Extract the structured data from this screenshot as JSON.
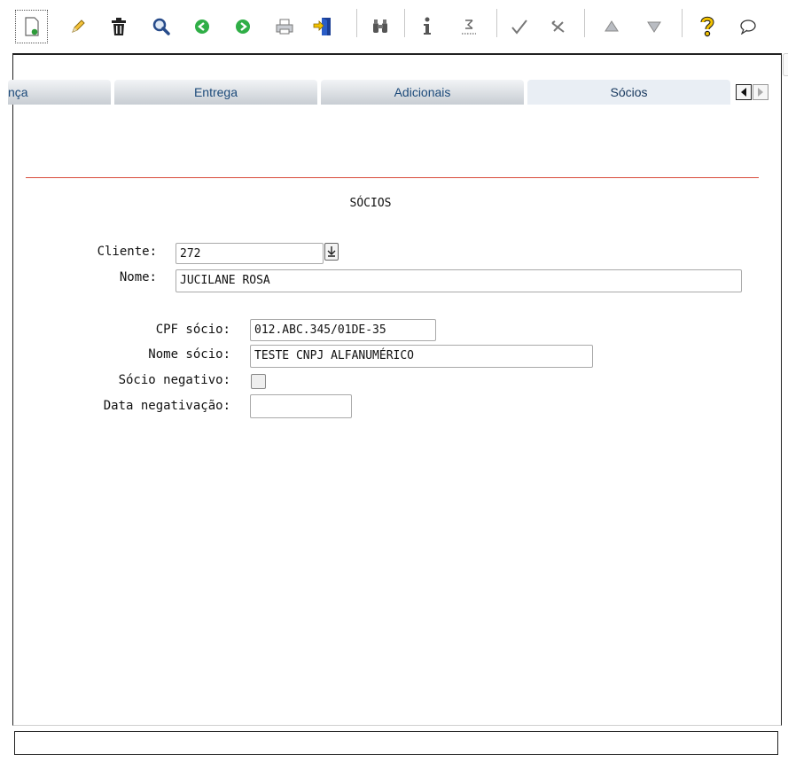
{
  "toolbar": {
    "icons": [
      "new-record-icon",
      "edit-icon",
      "delete-icon",
      "search-icon",
      "previous-icon",
      "next-icon",
      "print-icon",
      "exit-icon",
      "binoculars-icon",
      "info-icon",
      "sum-icon",
      "confirm-icon",
      "cancel-icon",
      "up-icon",
      "down-icon",
      "help-icon",
      "comment-icon"
    ]
  },
  "tabs": [
    {
      "label": "nça"
    },
    {
      "label": "Entrega"
    },
    {
      "label": "Adicionais"
    },
    {
      "label": "Sócios"
    }
  ],
  "form": {
    "section_title": "SÓCIOS",
    "cliente_label": "Cliente:",
    "cliente_value": "272",
    "nome_label": "Nome:",
    "nome_value": "JUCILANE ROSA",
    "cpf_label": "CPF sócio:",
    "cpf_value": "012.ABC.345/01DE-35",
    "nome_socio_label": "Nome sócio:",
    "nome_socio_value": "TESTE CNPJ ALFANUMÉRICO",
    "socio_negativo_label": "Sócio negativo:",
    "socio_negativo_checked": false,
    "data_neg_label": "Data negativação:",
    "data_neg_value": ""
  },
  "colors": {
    "accent_line": "#d84a3a",
    "tab_text": "#1c4a7a",
    "add_green": "#2e9b3a",
    "help_yellow": "#f2c200"
  }
}
